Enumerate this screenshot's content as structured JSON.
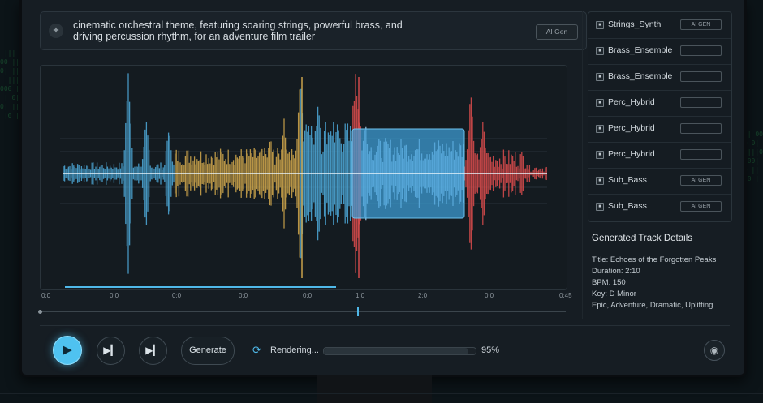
{
  "background": {
    "code_left": [
      "|||| 000 ||||| 00.",
      "00 |||| 000",
      "0| ||| 0||",
      "  |||| 00 ||",
      "000 |||| 0",
      "|| 0|| ||00",
      "0| ||| 0||",
      "||0 ||||0 00"
    ],
    "code_right": [
      "0||0|| 00",
      "|||| 0 0||",
      "00 ||||0",
      "|0 ||| 00||",
      "||| 00 |||",
      "0 ||0 ||"
    ]
  },
  "prompt": {
    "text": "cinematic orchestral theme, featuring soaring strings, powerful brass, and driving percussion rhythm, for an adventure film trailer",
    "button": "AI Gen"
  },
  "timeline": {
    "labels": [
      "0:0",
      "0:0",
      "0:0",
      "0:0",
      "0:0",
      "1:0",
      "2:0",
      "0:0",
      "0:45"
    ]
  },
  "tracks": [
    {
      "name": "Strings_Synth",
      "tag": "AI GEN"
    },
    {
      "name": "Brass_Ensemble",
      "tag": ""
    },
    {
      "name": "Brass_Ensemble",
      "tag": ""
    },
    {
      "name": "Perc_Hybrid",
      "tag": ""
    },
    {
      "name": "Perc_Hybrid",
      "tag": ""
    },
    {
      "name": "Perc_Hybrid",
      "tag": ""
    },
    {
      "name": "Sub_Bass",
      "tag": "AI GEN"
    },
    {
      "name": "Sub_Bass",
      "tag": "AI GEN"
    }
  ],
  "details": {
    "title": "Generated Track Details",
    "title_line": "Title: Echoes of the Forgotten Peaks",
    "duration": "Duration: 2:10",
    "bpm": "BPM: 150",
    "key": "Key: D Minor",
    "tags": "Epic, Adventure, Dramatic, Uplifting"
  },
  "transport": {
    "generate": "Generate",
    "rendering": "Rendering...",
    "percent_label": "95%",
    "progress": 0.95
  },
  "icons": {
    "prompt": "sparkle-icon",
    "play": "play-icon",
    "skip": "skip-next-icon",
    "render": "sync-icon",
    "settings": "settings-icon"
  },
  "colors": {
    "accent": "#4fc2f0",
    "strings": "#4aa3d0",
    "brass": "#c9a24a",
    "percussion": "#d24a4a",
    "selection": "#3f9fd8"
  }
}
